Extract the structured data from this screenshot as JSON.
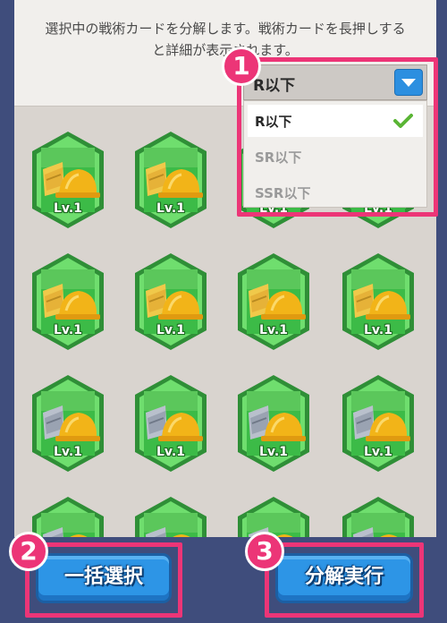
{
  "info": {
    "line1": "選択中の戦術カードを分解します。戦術カードを長押しする",
    "line2": "と詳細が表示されます。"
  },
  "filter": {
    "selected": "R以下",
    "options": [
      {
        "label": "R以下",
        "state": "selected"
      },
      {
        "label": "SR以下",
        "state": "disabled"
      },
      {
        "label": "SSR以下",
        "state": "disabled"
      }
    ]
  },
  "cards": {
    "level_label": "Lv.1",
    "rows": [
      [
        "gold",
        "gold",
        "gold",
        "gold"
      ],
      [
        "gold",
        "gold",
        "gold",
        "gold"
      ],
      [
        "silver",
        "silver",
        "silver",
        "silver"
      ],
      [
        "silver",
        "silver",
        "silver",
        "silver"
      ]
    ]
  },
  "buttons": {
    "select_all": "一括選択",
    "dismantle": "分解実行"
  },
  "badges": [
    "1",
    "2",
    "3"
  ],
  "colors": {
    "highlight": "#ec3577",
    "button": "#2d95e6",
    "card_green": "#3cbb47"
  }
}
